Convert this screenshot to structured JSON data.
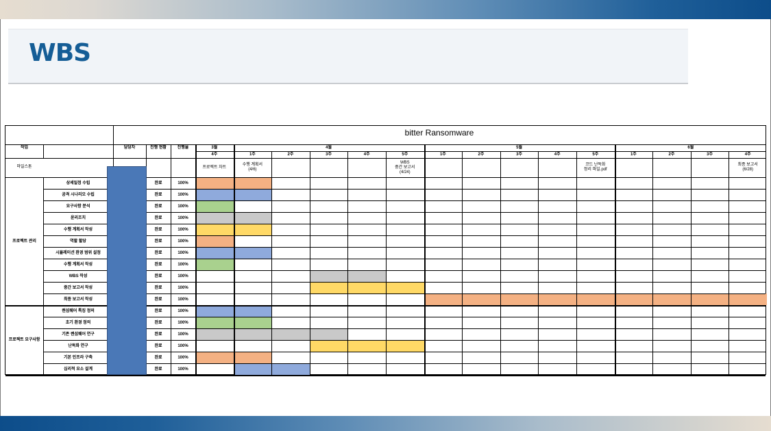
{
  "slide_title": "WBS",
  "project_title": "bitter Ransomware",
  "headers": {
    "task": "작업",
    "owner": "담당자",
    "status": "진행 현황",
    "progress": "진행율"
  },
  "milestone_label": "마일스톤",
  "months": [
    "3월",
    "4월",
    "5월",
    "6월"
  ],
  "weeks": [
    "4주",
    "1주",
    "2주",
    "3주",
    "4주",
    "5주",
    "1주",
    "2주",
    "3주",
    "4주",
    "5주",
    "1주",
    "2주",
    "3주",
    "4주"
  ],
  "month_span": [
    1,
    5,
    5,
    4
  ],
  "milestones": [
    {
      "col": 0,
      "lines": [
        "프로젝트 차트"
      ]
    },
    {
      "col": 1,
      "lines": [
        "수행 계획서",
        "(4/6)"
      ]
    },
    {
      "col": 5,
      "lines": [
        "WBS",
        "중간 보고서",
        "(4/24)"
      ]
    },
    {
      "col": 10,
      "lines": [
        "코드 난독화",
        "정리 파일.pdf"
      ]
    },
    {
      "col": 14,
      "lines": [
        "최종 보고서",
        "(6/28)"
      ]
    }
  ],
  "colors": {
    "orange": "#f4b183",
    "blue": "#8faadc",
    "green": "#a9d18e",
    "gray": "#c9c9c9",
    "yellow": "#ffd966",
    "owner": "#4a78b7",
    "title": "#155d96"
  },
  "groups": [
    {
      "name": "프로젝트 관리",
      "tasks": [
        {
          "name": "상세일정 수립",
          "status": "완료",
          "progress": "100%",
          "bars": [
            [
              0,
              1,
              "orange"
            ]
          ]
        },
        {
          "name": "공격 시나리오 수립",
          "status": "완료",
          "progress": "100%",
          "bars": [
            [
              0,
              1,
              "blue"
            ]
          ]
        },
        {
          "name": "요구사항 분석",
          "status": "완료",
          "progress": "100%",
          "bars": [
            [
              0,
              0,
              "green"
            ]
          ]
        },
        {
          "name": "윤리조치",
          "status": "완료",
          "progress": "100%",
          "bars": [
            [
              0,
              1,
              "gray"
            ]
          ]
        },
        {
          "name": "수행 계획서 작성",
          "status": "완료",
          "progress": "100%",
          "bars": [
            [
              0,
              1,
              "yellow"
            ]
          ]
        },
        {
          "name": "역할 할당",
          "status": "완료",
          "progress": "100%",
          "bars": [
            [
              0,
              0,
              "orange"
            ]
          ]
        },
        {
          "name": "시뮬레이션 환경 범위 설정",
          "status": "완료",
          "progress": "100%",
          "bars": [
            [
              0,
              1,
              "blue"
            ]
          ]
        },
        {
          "name": "수행 계획서 작성",
          "status": "완료",
          "progress": "100%",
          "bars": [
            [
              0,
              0,
              "green"
            ]
          ]
        },
        {
          "name": "WBS 작성",
          "status": "완료",
          "progress": "100%",
          "bars": [
            [
              3,
              4,
              "gray"
            ]
          ]
        },
        {
          "name": "중간 보고서 작성",
          "status": "완료",
          "progress": "100%",
          "bars": [
            [
              3,
              5,
              "yellow"
            ]
          ]
        },
        {
          "name": "최종 보고서 작성",
          "status": "완료",
          "progress": "100%",
          "bars": [
            [
              6,
              14,
              "orange"
            ]
          ]
        }
      ]
    },
    {
      "name": "프로젝트 요구사항",
      "tasks": [
        {
          "name": "랜섬웨어 특징 정의",
          "status": "완료",
          "progress": "100%",
          "bars": [
            [
              0,
              1,
              "blue"
            ]
          ]
        },
        {
          "name": "초기 환경 정의",
          "status": "완료",
          "progress": "100%",
          "bars": [
            [
              0,
              1,
              "green"
            ]
          ]
        },
        {
          "name": "기존 랜섬웨어 연구",
          "status": "완료",
          "progress": "100%",
          "bars": [
            [
              0,
              3,
              "gray"
            ]
          ]
        },
        {
          "name": "난독화 연구",
          "status": "완료",
          "progress": "100%",
          "bars": [
            [
              3,
              5,
              "yellow"
            ]
          ]
        },
        {
          "name": "기본 인프라 구축",
          "status": "완료",
          "progress": "100%",
          "bars": [
            [
              0,
              1,
              "orange"
            ]
          ]
        },
        {
          "name": "심리적 요소 설계",
          "status": "완료",
          "progress": "100%",
          "bars": [
            [
              1,
              2,
              "blue"
            ]
          ]
        }
      ]
    }
  ]
}
